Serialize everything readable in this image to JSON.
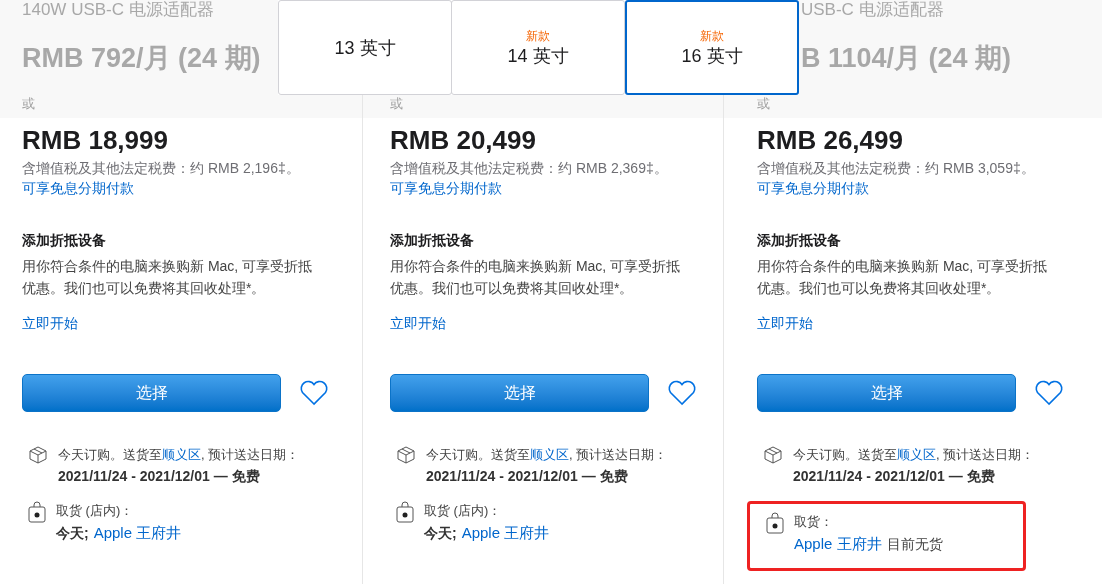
{
  "size_tabs": [
    {
      "label": "13 英寸",
      "selected": false
    },
    {
      "badge": "新款",
      "label": "14 英寸",
      "selected": false
    },
    {
      "badge": "新款",
      "label": "16 英寸",
      "selected": true
    }
  ],
  "columns": [
    {
      "faded_title": "140W USB-C 电源适配器",
      "faded_monthly": "RMB 792/月 (24 期)",
      "faded_or": "或",
      "price": "RMB 18,999",
      "tax": "含增值税及其他法定税费：约 RMB 2,196‡。",
      "installment_link": "可享免息分期付款",
      "tradein_title": "添加折抵设备",
      "tradein_text": "用你符合条件的电脑来换购新 Mac, 可享受折抵优惠。我们也可以免费将其回收处理*。",
      "start_link": "立即开始",
      "select_button": "选择",
      "delivery_prefix": "今天订购。送货至",
      "delivery_area": "顺义区",
      "delivery_suffix": ", 预计送达日期：",
      "delivery_dates": "2021/11/24 - 2021/12/01 — 免费",
      "pickup_label": "取货 (店内)：",
      "pickup_day": "今天;",
      "pickup_store": "Apple 王府井",
      "highlighted": false
    },
    {
      "faded_or": "或",
      "price": "RMB 20,499",
      "tax": "含增值税及其他法定税费：约 RMB 2,369‡。",
      "installment_link": "可享免息分期付款",
      "tradein_title": "添加折抵设备",
      "tradein_text": "用你符合条件的电脑来换购新 Mac, 可享受折抵优惠。我们也可以免费将其回收处理*。",
      "start_link": "立即开始",
      "select_button": "选择",
      "delivery_prefix": "今天订购。送货至",
      "delivery_area": "顺义区",
      "delivery_suffix": ", 预计送达日期：",
      "delivery_dates": "2021/11/24 - 2021/12/01 — 免费",
      "pickup_label": "取货 (店内)：",
      "pickup_day": "今天;",
      "pickup_store": "Apple 王府井",
      "highlighted": false
    },
    {
      "faded_title": "USB-C 电源适配器",
      "faded_monthly": "B 1104/月 (24 期)",
      "faded_or": "或",
      "price": "RMB 26,499",
      "tax": "含增值税及其他法定税费：约 RMB 3,059‡。",
      "installment_link": "可享免息分期付款",
      "tradein_title": "添加折抵设备",
      "tradein_text": "用你符合条件的电脑来换购新 Mac, 可享受折抵优惠。我们也可以免费将其回收处理*。",
      "start_link": "立即开始",
      "select_button": "选择",
      "delivery_prefix": "今天订购。送货至",
      "delivery_area": "顺义区",
      "delivery_suffix": ", 预计送达日期：",
      "delivery_dates": "2021/11/24 - 2021/12/01 — 免费",
      "pickup_label": "取货：",
      "pickup_store": "Apple 王府井",
      "pickup_status": "目前无货",
      "highlighted": true
    }
  ]
}
